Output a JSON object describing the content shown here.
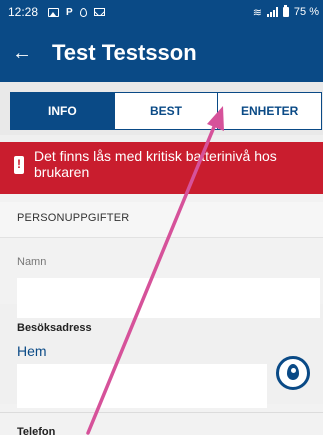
{
  "statusbar": {
    "time": "12:28",
    "battery": "75 %"
  },
  "appbar": {
    "title": "Test Testsson"
  },
  "tabs": [
    {
      "label": "INFO",
      "active": true
    },
    {
      "label": "BEST",
      "active": false
    },
    {
      "label": "ENHETER",
      "active": false
    }
  ],
  "alert": {
    "text": "Det finns lås med kritisk batterinivå hos brukaren"
  },
  "personal": {
    "section_title": "PERSONUPPGIFTER",
    "name_label": "Namn",
    "visit_address_label": "Besöksadress",
    "address_link": "Hem",
    "phone_label": "Telefon"
  },
  "colors": {
    "primary": "#0a4a86",
    "alert": "#c91d2e",
    "annotation": "#d6529a"
  }
}
